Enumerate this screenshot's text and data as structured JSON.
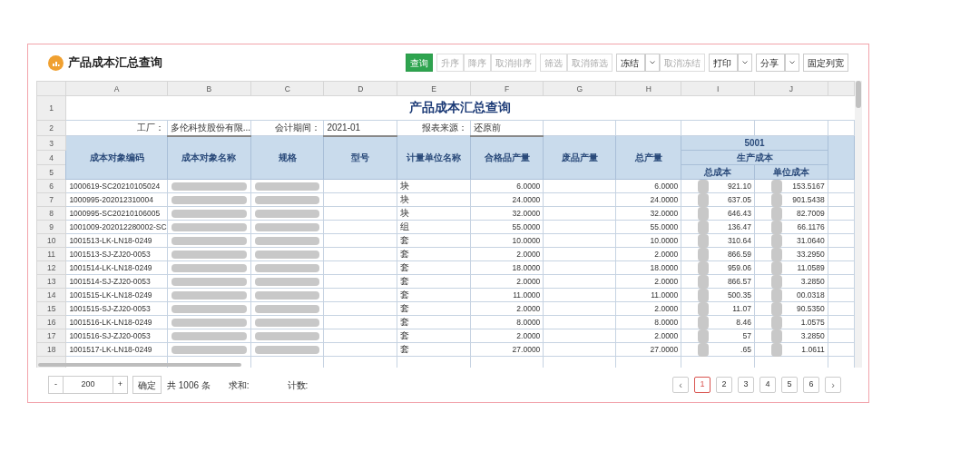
{
  "title": "产品成本汇总查询",
  "toolbar": [
    {
      "label": "查询",
      "kind": "primary",
      "caret": false
    },
    {
      "label": "升序",
      "kind": "disabled",
      "caret": false,
      "group_start": true
    },
    {
      "label": "降序",
      "kind": "disabled",
      "caret": false
    },
    {
      "label": "取消排序",
      "kind": "disabled",
      "caret": false
    },
    {
      "label": "筛选",
      "kind": "disabled",
      "caret": false,
      "group_start": true
    },
    {
      "label": "取消筛选",
      "kind": "disabled",
      "caret": false
    },
    {
      "label": "冻结",
      "kind": "normal",
      "caret": true,
      "group_start": true
    },
    {
      "label": "取消冻结",
      "kind": "disabled",
      "caret": false
    },
    {
      "label": "打印",
      "kind": "normal",
      "caret": true,
      "group_start": true
    },
    {
      "label": "分享",
      "kind": "normal",
      "caret": true,
      "group_start": true
    },
    {
      "label": "固定列宽",
      "kind": "normal",
      "caret": false,
      "group_start": true
    }
  ],
  "column_letters": [
    "A",
    "B",
    "C",
    "D",
    "E",
    "F",
    "G",
    "H",
    "I",
    "J"
  ],
  "sheet_title": "产品成本汇总查询",
  "header_row_numbers": [
    "1",
    "2",
    "3",
    "4",
    "5"
  ],
  "filters": [
    {
      "label": "工厂：",
      "value": "多伦科技股份有限..."
    },
    {
      "label": "会计期间：",
      "value": "2021-01"
    },
    {
      "label": "报表来源：",
      "value": "还原前"
    }
  ],
  "headers": [
    "成本对象编码",
    "成本对象名称",
    "规格",
    "型号",
    "计量单位名称",
    "合格品产量",
    "废品产量",
    "总产量"
  ],
  "group_header": "5001",
  "subgroup_header": "生产成本",
  "sub_headers": [
    "总成本",
    "单位成本"
  ],
  "rows": [
    {
      "number": "6",
      "code": "1000619-SC20210105024",
      "unit": "块",
      "good_qty": "6.0000",
      "total_qty": "6.0000",
      "total_cost": "921.10",
      "unit_cost": "153.5167"
    },
    {
      "number": "7",
      "code": "1000995-202012310004",
      "unit": "块",
      "good_qty": "24.0000",
      "total_qty": "24.0000",
      "total_cost": "637.05",
      "unit_cost": "901.5438"
    },
    {
      "number": "8",
      "code": "1000995-SC20210106005",
      "unit": "块",
      "good_qty": "32.0000",
      "total_qty": "32.0000",
      "total_cost": "646.43",
      "unit_cost": "82.7009"
    },
    {
      "number": "9",
      "code": "1001009-202012280002-SC",
      "unit": "组",
      "good_qty": "55.0000",
      "total_qty": "55.0000",
      "total_cost": "136.47",
      "unit_cost": "66.1176"
    },
    {
      "number": "10",
      "code": "1001513-LK-LN18-0249",
      "unit": "套",
      "good_qty": "10.0000",
      "total_qty": "10.0000",
      "total_cost": "310.64",
      "unit_cost": "31.0640"
    },
    {
      "number": "11",
      "code": "1001513-SJ-ZJ20-0053",
      "unit": "套",
      "good_qty": "2.0000",
      "total_qty": "2.0000",
      "total_cost": "866.59",
      "unit_cost": "33.2950"
    },
    {
      "number": "12",
      "code": "1001514-LK-LN18-0249",
      "unit": "套",
      "good_qty": "18.0000",
      "total_qty": "18.0000",
      "total_cost": "959.06",
      "unit_cost": "11.0589"
    },
    {
      "number": "13",
      "code": "1001514-SJ-ZJ20-0053",
      "unit": "套",
      "good_qty": "2.0000",
      "total_qty": "2.0000",
      "total_cost": "866.57",
      "unit_cost": "3.2850"
    },
    {
      "number": "14",
      "code": "1001515-LK-LN18-0249",
      "unit": "套",
      "good_qty": "11.0000",
      "total_qty": "11.0000",
      "total_cost": "500.35",
      "unit_cost": "00.0318"
    },
    {
      "number": "15",
      "code": "1001515-SJ-ZJ20-0053",
      "unit": "套",
      "good_qty": "2.0000",
      "total_qty": "2.0000",
      "total_cost": "11.07",
      "unit_cost": "90.5350"
    },
    {
      "number": "16",
      "code": "1001516-LK-LN18-0249",
      "unit": "套",
      "good_qty": "8.0000",
      "total_qty": "8.0000",
      "total_cost": "8.46",
      "unit_cost": "1.0575"
    },
    {
      "number": "17",
      "code": "1001516-SJ-ZJ20-0053",
      "unit": "套",
      "good_qty": "2.0000",
      "total_qty": "2.0000",
      "total_cost": "57",
      "unit_cost": "3.2850"
    },
    {
      "number": "18",
      "code": "1001517-LK-LN18-0249",
      "unit": "套",
      "good_qty": "27.0000",
      "total_qty": "27.0000",
      "total_cost": ".65",
      "unit_cost": "1.0611"
    }
  ],
  "footer": {
    "minus": "-",
    "page_size": "200",
    "plus": "+",
    "confirm": "确定",
    "total": "共 1006 条",
    "sum_label": "求和:",
    "count_label": "计数:"
  },
  "pages": [
    {
      "label": "‹",
      "kind": "prev",
      "selected": false
    },
    {
      "label": "1",
      "kind": "page",
      "selected": true
    },
    {
      "label": "2",
      "kind": "page",
      "selected": false
    },
    {
      "label": "3",
      "kind": "page",
      "selected": false
    },
    {
      "label": "4",
      "kind": "page",
      "selected": false
    },
    {
      "label": "5",
      "kind": "page",
      "selected": false
    },
    {
      "label": "6",
      "kind": "page",
      "selected": false
    },
    {
      "label": "›",
      "kind": "next",
      "selected": false
    }
  ]
}
